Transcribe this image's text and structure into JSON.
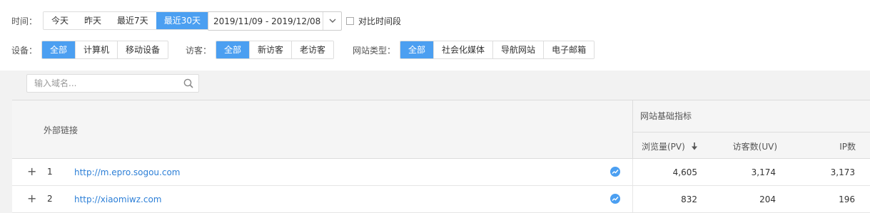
{
  "filters": {
    "time": {
      "label": "时间：",
      "options": [
        "今天",
        "昨天",
        "最近7天",
        "最近30天"
      ],
      "active": "最近30天",
      "date_range": "2019/11/09 - 2019/12/08",
      "compare_label": "对比时间段"
    },
    "device": {
      "label": "设备：",
      "options": [
        "全部",
        "计算机",
        "移动设备"
      ],
      "active": "全部"
    },
    "visitor": {
      "label": "访客：",
      "options": [
        "全部",
        "新访客",
        "老访客"
      ],
      "active": "全部"
    },
    "site_type": {
      "label": "网站类型：",
      "options": [
        "全部",
        "社会化媒体",
        "导航网站",
        "电子邮箱"
      ],
      "active": "全部"
    }
  },
  "search": {
    "placeholder": "输入域名..."
  },
  "table": {
    "col_external": "外部链接",
    "group_title": "网站基础指标",
    "col_pv": "浏览量(PV)",
    "col_uv": "访客数(UV)",
    "col_ip": "IP数",
    "rows": [
      {
        "index": "1",
        "url": "http://m.epro.sogou.com",
        "pv": "4,605",
        "uv": "3,174",
        "ip": "3,173"
      },
      {
        "index": "2",
        "url": "http://xiaomiwz.com",
        "pv": "832",
        "uv": "204",
        "ip": "196"
      }
    ]
  },
  "colors": {
    "accent": "#4b9ff1",
    "link": "#2c7fd7"
  },
  "icons": {
    "expand": "plus-icon",
    "trend": "trend-icon",
    "sort": "sort-down-icon",
    "search": "search-icon",
    "dropdown": "chevron-down-icon"
  }
}
